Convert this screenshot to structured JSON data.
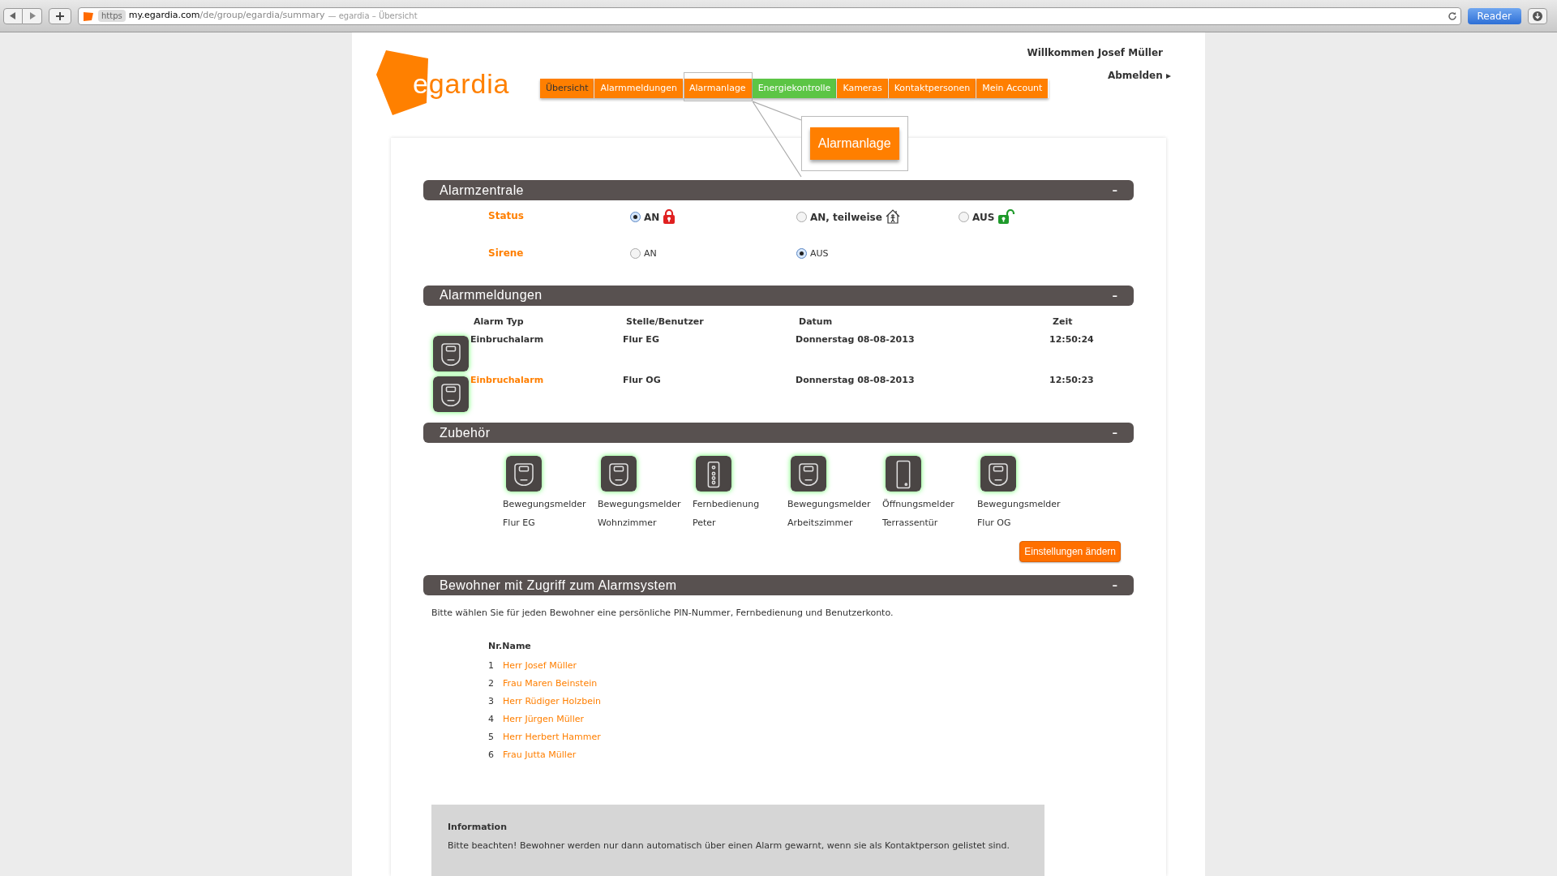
{
  "browser": {
    "protocol": "https",
    "url_host": "my.egardia.com",
    "url_path": "/de/group/egardia/summary",
    "page_title": "— egardia – Übersicht",
    "reader": "Reader"
  },
  "header": {
    "logo": "egardia",
    "welcome": "Willkommen Josef Müller",
    "logout": "Abmelden ▸"
  },
  "nav": [
    {
      "label": "Übersicht",
      "selected": true,
      "outlined": false,
      "color": "#ff7f00"
    },
    {
      "label": "Alarmmeldungen",
      "selected": false,
      "outlined": false,
      "color": "#ff7f00"
    },
    {
      "label": "Alarmanlage",
      "selected": false,
      "outlined": true,
      "color": "#ff7f00"
    },
    {
      "label": "Energiekontrolle",
      "selected": false,
      "outlined": false,
      "color": "#5cc545"
    },
    {
      "label": "Kameras",
      "selected": false,
      "outlined": false,
      "color": "#ff7f00"
    },
    {
      "label": "Kontaktpersonen",
      "selected": false,
      "outlined": false,
      "color": "#ff7f00"
    },
    {
      "label": "Mein Account",
      "selected": false,
      "outlined": false,
      "color": "#ff7f00"
    }
  ],
  "callout": {
    "label": "Alarmanlage"
  },
  "alarmzentrale": {
    "title": "Alarmzentrale",
    "collapse": "–",
    "rows": [
      {
        "label": "Status",
        "options": [
          {
            "label": "AN",
            "selected": true,
            "kind": "locked"
          },
          {
            "label": "AN, teilweise",
            "selected": false,
            "kind": "partial"
          },
          {
            "label": "AUS",
            "selected": false,
            "kind": "unlocked"
          }
        ]
      },
      {
        "label": "Sirene",
        "options": [
          {
            "label": "AN",
            "selected": false,
            "kind": "plain"
          },
          {
            "label": "AUS",
            "selected": true,
            "kind": "plain"
          }
        ]
      }
    ]
  },
  "alarmmeldungen": {
    "title": "Alarmmeldungen",
    "collapse": "–",
    "columns": [
      "Alarm Typ",
      "Stelle/Benutzer",
      "Datum",
      "Zeit"
    ],
    "rows": [
      {
        "type": "Einbruchalarm",
        "place": "Flur EG",
        "date": "Donnerstag 08-08-2013",
        "time": "12:50:24",
        "selected": false
      },
      {
        "type": "Einbruchalarm",
        "place": "Flur OG",
        "date": "Donnerstag 08-08-2013",
        "time": "12:50:23",
        "selected": true
      }
    ]
  },
  "zubehoer": {
    "title": "Zubehör",
    "collapse": "–",
    "items": [
      {
        "kind": "motion",
        "name": "Bewegungsmelder",
        "place": "Flur EG"
      },
      {
        "kind": "motion",
        "name": "Bewegungsmelder",
        "place": "Wohnzimmer"
      },
      {
        "kind": "remote",
        "name": "Fernbedienung",
        "place": "Peter"
      },
      {
        "kind": "motion",
        "name": "Bewegungsmelder",
        "place": "Arbeitszimmer"
      },
      {
        "kind": "contact",
        "name": "Öffnungsmelder",
        "place": "Terrassentür"
      },
      {
        "kind": "motion",
        "name": "Bewegungsmelder",
        "place": "Flur OG"
      }
    ],
    "button": "Einstellungen ändern"
  },
  "bewohner": {
    "title": "Bewohner mit Zugriff zum Alarmsystem",
    "collapse": "–",
    "intro": "Bitte wählen Sie für jeden Bewohner eine persönliche PIN-Nummer, Fernbedienung und Benutzerkonto.",
    "column_1": "Nr.",
    "column_2": "Name",
    "rows": [
      {
        "nr": "1",
        "name": "Herr Josef Müller"
      },
      {
        "nr": "2",
        "name": "Frau Maren Beinstein"
      },
      {
        "nr": "3",
        "name": "Herr Rüdiger Holzbein"
      },
      {
        "nr": "4",
        "name": "Herr Jürgen Müller"
      },
      {
        "nr": "5",
        "name": "Herr Herbert Hammer"
      },
      {
        "nr": "6",
        "name": "Frau Jutta Müller"
      }
    ]
  },
  "information": {
    "title": "Information",
    "text": "Bitte beachten! Bewohner werden nur dann automatisch über einen Alarm gewarnt, wenn sie als Kontaktperson gelistet sind."
  }
}
